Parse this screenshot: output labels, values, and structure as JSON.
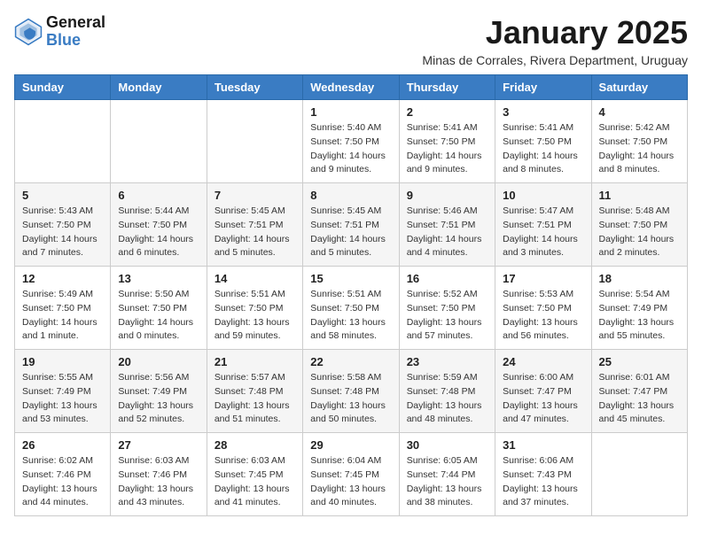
{
  "header": {
    "logo_line1": "General",
    "logo_line2": "Blue",
    "month": "January 2025",
    "location": "Minas de Corrales, Rivera Department, Uruguay"
  },
  "days_of_week": [
    "Sunday",
    "Monday",
    "Tuesday",
    "Wednesday",
    "Thursday",
    "Friday",
    "Saturday"
  ],
  "weeks": [
    [
      {
        "day": "",
        "info": ""
      },
      {
        "day": "",
        "info": ""
      },
      {
        "day": "",
        "info": ""
      },
      {
        "day": "1",
        "info": "Sunrise: 5:40 AM\nSunset: 7:50 PM\nDaylight: 14 hours\nand 9 minutes."
      },
      {
        "day": "2",
        "info": "Sunrise: 5:41 AM\nSunset: 7:50 PM\nDaylight: 14 hours\nand 9 minutes."
      },
      {
        "day": "3",
        "info": "Sunrise: 5:41 AM\nSunset: 7:50 PM\nDaylight: 14 hours\nand 8 minutes."
      },
      {
        "day": "4",
        "info": "Sunrise: 5:42 AM\nSunset: 7:50 PM\nDaylight: 14 hours\nand 8 minutes."
      }
    ],
    [
      {
        "day": "5",
        "info": "Sunrise: 5:43 AM\nSunset: 7:50 PM\nDaylight: 14 hours\nand 7 minutes."
      },
      {
        "day": "6",
        "info": "Sunrise: 5:44 AM\nSunset: 7:50 PM\nDaylight: 14 hours\nand 6 minutes."
      },
      {
        "day": "7",
        "info": "Sunrise: 5:45 AM\nSunset: 7:51 PM\nDaylight: 14 hours\nand 5 minutes."
      },
      {
        "day": "8",
        "info": "Sunrise: 5:45 AM\nSunset: 7:51 PM\nDaylight: 14 hours\nand 5 minutes."
      },
      {
        "day": "9",
        "info": "Sunrise: 5:46 AM\nSunset: 7:51 PM\nDaylight: 14 hours\nand 4 minutes."
      },
      {
        "day": "10",
        "info": "Sunrise: 5:47 AM\nSunset: 7:51 PM\nDaylight: 14 hours\nand 3 minutes."
      },
      {
        "day": "11",
        "info": "Sunrise: 5:48 AM\nSunset: 7:50 PM\nDaylight: 14 hours\nand 2 minutes."
      }
    ],
    [
      {
        "day": "12",
        "info": "Sunrise: 5:49 AM\nSunset: 7:50 PM\nDaylight: 14 hours\nand 1 minute."
      },
      {
        "day": "13",
        "info": "Sunrise: 5:50 AM\nSunset: 7:50 PM\nDaylight: 14 hours\nand 0 minutes."
      },
      {
        "day": "14",
        "info": "Sunrise: 5:51 AM\nSunset: 7:50 PM\nDaylight: 13 hours\nand 59 minutes."
      },
      {
        "day": "15",
        "info": "Sunrise: 5:51 AM\nSunset: 7:50 PM\nDaylight: 13 hours\nand 58 minutes."
      },
      {
        "day": "16",
        "info": "Sunrise: 5:52 AM\nSunset: 7:50 PM\nDaylight: 13 hours\nand 57 minutes."
      },
      {
        "day": "17",
        "info": "Sunrise: 5:53 AM\nSunset: 7:50 PM\nDaylight: 13 hours\nand 56 minutes."
      },
      {
        "day": "18",
        "info": "Sunrise: 5:54 AM\nSunset: 7:49 PM\nDaylight: 13 hours\nand 55 minutes."
      }
    ],
    [
      {
        "day": "19",
        "info": "Sunrise: 5:55 AM\nSunset: 7:49 PM\nDaylight: 13 hours\nand 53 minutes."
      },
      {
        "day": "20",
        "info": "Sunrise: 5:56 AM\nSunset: 7:49 PM\nDaylight: 13 hours\nand 52 minutes."
      },
      {
        "day": "21",
        "info": "Sunrise: 5:57 AM\nSunset: 7:48 PM\nDaylight: 13 hours\nand 51 minutes."
      },
      {
        "day": "22",
        "info": "Sunrise: 5:58 AM\nSunset: 7:48 PM\nDaylight: 13 hours\nand 50 minutes."
      },
      {
        "day": "23",
        "info": "Sunrise: 5:59 AM\nSunset: 7:48 PM\nDaylight: 13 hours\nand 48 minutes."
      },
      {
        "day": "24",
        "info": "Sunrise: 6:00 AM\nSunset: 7:47 PM\nDaylight: 13 hours\nand 47 minutes."
      },
      {
        "day": "25",
        "info": "Sunrise: 6:01 AM\nSunset: 7:47 PM\nDaylight: 13 hours\nand 45 minutes."
      }
    ],
    [
      {
        "day": "26",
        "info": "Sunrise: 6:02 AM\nSunset: 7:46 PM\nDaylight: 13 hours\nand 44 minutes."
      },
      {
        "day": "27",
        "info": "Sunrise: 6:03 AM\nSunset: 7:46 PM\nDaylight: 13 hours\nand 43 minutes."
      },
      {
        "day": "28",
        "info": "Sunrise: 6:03 AM\nSunset: 7:45 PM\nDaylight: 13 hours\nand 41 minutes."
      },
      {
        "day": "29",
        "info": "Sunrise: 6:04 AM\nSunset: 7:45 PM\nDaylight: 13 hours\nand 40 minutes."
      },
      {
        "day": "30",
        "info": "Sunrise: 6:05 AM\nSunset: 7:44 PM\nDaylight: 13 hours\nand 38 minutes."
      },
      {
        "day": "31",
        "info": "Sunrise: 6:06 AM\nSunset: 7:43 PM\nDaylight: 13 hours\nand 37 minutes."
      },
      {
        "day": "",
        "info": ""
      }
    ]
  ]
}
